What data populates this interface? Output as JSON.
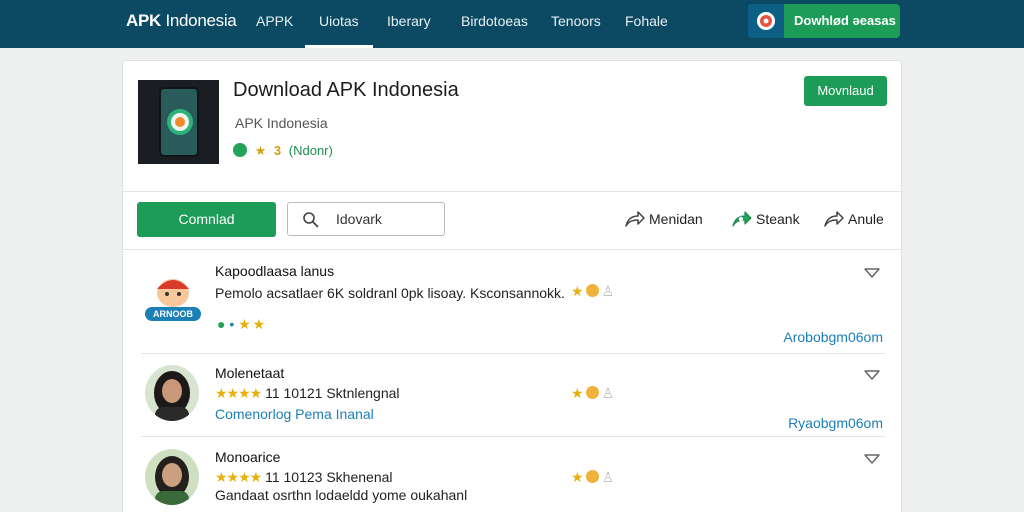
{
  "header": {
    "brand_bold": "APK",
    "brand_light": "Indonesia",
    "nav": [
      "APPK",
      "Uiotas",
      "Iberary",
      "Birdotoeas",
      "Tenoors",
      "Fohale"
    ],
    "active_nav": "Uiotas",
    "cta_label": "Dowhlød əeasas",
    "cta_icon": "logo-badge-icon"
  },
  "app": {
    "title": "Download APK Indonesia",
    "subtitle": "APK Indonesia",
    "rating_num": "3",
    "tag": "(Ndonr)",
    "install_label": "Movnlaud"
  },
  "toolbar": {
    "primary_label": "Comnlad",
    "search_value": "Idovark",
    "actions": [
      {
        "icon": "share-icon",
        "label": "Menidan"
      },
      {
        "icon": "favorite-share-icon",
        "label": "Steank"
      },
      {
        "icon": "forward-icon",
        "label": "Anule"
      }
    ]
  },
  "reviews": [
    {
      "name": "Kapoodlaasa lanus",
      "text": "Pemolo acsatlaer 6K soldranl 0pk lisoay. Ksconsannokk.",
      "badges": "★ ★",
      "site": "Arobobgm06om",
      "avatar": "mascot-logo",
      "avatar_label": "ARNOOB"
    },
    {
      "name": "Molenetaat",
      "stars": "★★★★",
      "meta": "11 10121 Sktnlengnal",
      "link": "Comenorlog Pema Inanal",
      "site": "Ryaobgm06om",
      "avatar": "woman-portrait"
    },
    {
      "name": "Monoarice",
      "stars": "★★★★",
      "meta": "11 10123 Skhenenal",
      "text": "Gandaat osrthn lodaeldd yome oukahanl",
      "avatar": "woman-portrait"
    }
  ],
  "colors": {
    "topbar": "#0c4a63",
    "accent_green": "#1c9c57",
    "link_blue": "#1c7fb6",
    "star_gold": "#e8b00c"
  }
}
